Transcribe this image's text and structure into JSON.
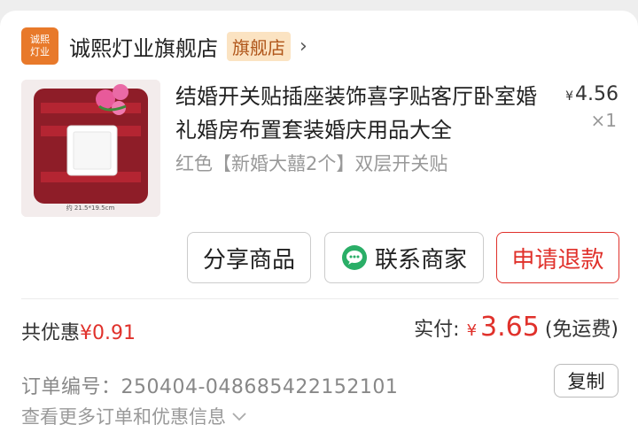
{
  "store": {
    "logo_line1": "诚熙",
    "logo_line2": "灯业",
    "name": "诚熙灯业旗舰店",
    "badge": "旗舰店",
    "chevron": "›"
  },
  "product": {
    "title": "结婚开关贴插座装饰喜字贴客厅卧室婚礼婚房布置套装婚庆用品大全",
    "spec": "红色【新婚大囍2个】双层开关贴",
    "price_symbol": "¥",
    "price": "4.56",
    "quantity": "×1",
    "image_size_text": "约 21.5*19.5cm"
  },
  "actions": {
    "share": "分享商品",
    "contact": "联系商家",
    "refund": "申请退款"
  },
  "summary": {
    "discount_label": "共优惠",
    "discount_value": "¥0.91",
    "paid_label": "实付:",
    "paid_symbol": "¥",
    "paid_value": "3.65",
    "shipping": "(免运费)"
  },
  "order": {
    "number_text": "订单编号：250404-048685422152101",
    "copy_label": "复制",
    "more_text": "查看更多订单和优惠信息"
  },
  "icons": {
    "chat": "wechat-chat-icon",
    "chevron": "chevron-down-icon"
  },
  "colors": {
    "accent": "#e0312b",
    "store_logo": "#e8792a",
    "badge_bg": "#fbe3c2"
  }
}
